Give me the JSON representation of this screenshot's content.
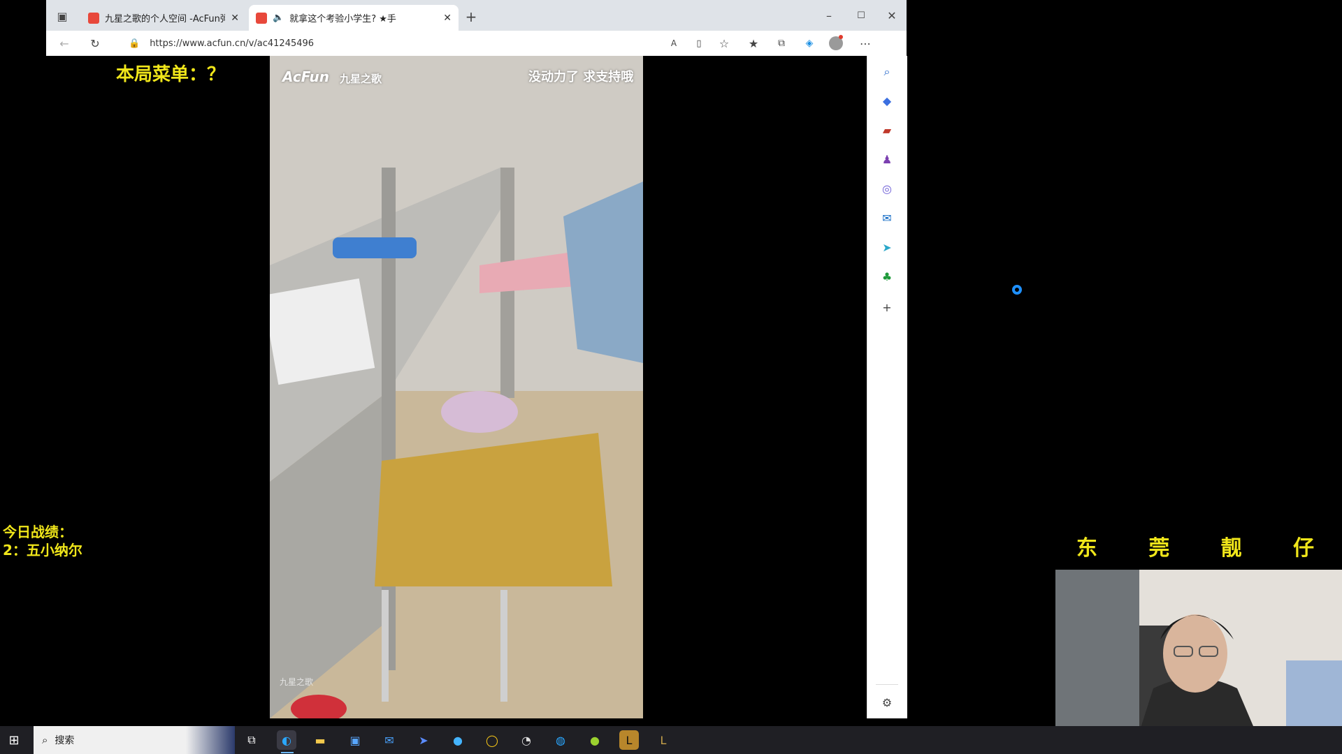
{
  "browser": {
    "tabs": [
      {
        "title": "九星之歌的个人空间 -AcFun弹幕",
        "active": false
      },
      {
        "title": "就拿这个考验小学生? ★手",
        "active": true,
        "audio": true
      }
    ],
    "url": "https://www.acfun.cn/v/ac41245496"
  },
  "video": {
    "brand_logo": "AcFun",
    "channel": "九星之歌",
    "caption": "没动力了 求支持哦",
    "bottom_watermark": "九星之歌"
  },
  "overlay": {
    "menu_label": "本局菜单：？",
    "record_title": "今日战绩：",
    "record_line": "2：五小纳尔",
    "streamer_name": [
      "东",
      "莞",
      "靓",
      "仔"
    ]
  },
  "taskbar": {
    "search_placeholder": "搜索"
  },
  "colors": {
    "overlay_text": "#f0e61a",
    "tabbar": "#dfe3e8",
    "taskbar": "#1f1f24",
    "loading_ring": "#1e90ff"
  },
  "icons": {
    "sidebar": [
      "search-icon",
      "tag-icon",
      "toolbox-icon",
      "chess-icon",
      "office-icon",
      "outlook-icon",
      "send-icon",
      "tree-icon",
      "add-icon",
      "settings-icon"
    ]
  }
}
